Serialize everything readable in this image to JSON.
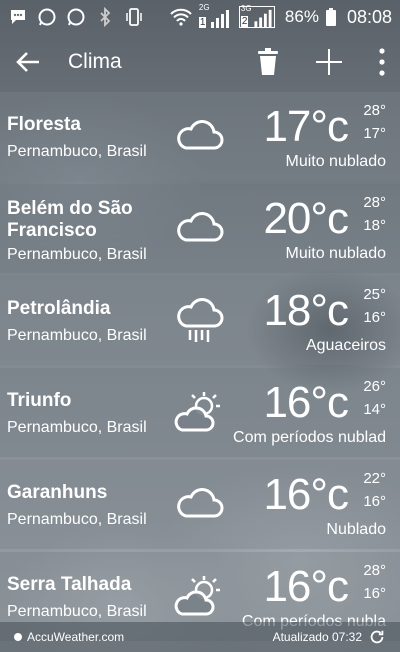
{
  "status": {
    "battery": "86%",
    "time": "08:08",
    "net1": "2G",
    "net2": "3G",
    "sim1": "1",
    "sim2": "2"
  },
  "appbar": {
    "title": "Clima"
  },
  "cities": [
    {
      "name": "Floresta",
      "region": "Pernambuco, Brasil",
      "temp": "17°c",
      "hi": "28°",
      "lo": "17°",
      "condition": "Muito nublado",
      "icon": "cloud"
    },
    {
      "name": "Belém do São Francisco",
      "region": "Pernambuco, Brasil",
      "temp": "20°c",
      "hi": "28°",
      "lo": "18°",
      "condition": "Muito nublado",
      "icon": "cloud"
    },
    {
      "name": "Petrolândia",
      "region": "Pernambuco, Brasil",
      "temp": "18°c",
      "hi": "25°",
      "lo": "16°",
      "condition": "Aguaceiros",
      "icon": "rain"
    },
    {
      "name": "Triunfo",
      "region": "Pernambuco, Brasil",
      "temp": "16°c",
      "hi": "26°",
      "lo": "14°",
      "condition": "Com períodos nublad",
      "icon": "partly-cloudy"
    },
    {
      "name": "Garanhuns",
      "region": "Pernambuco, Brasil",
      "temp": "16°c",
      "hi": "22°",
      "lo": "16°",
      "condition": "Nublado",
      "icon": "cloud"
    },
    {
      "name": "Serra Talhada",
      "region": "Pernambuco, Brasil",
      "temp": "16°c",
      "hi": "28°",
      "lo": "16°",
      "condition": "Com períodos nubla",
      "icon": "partly-cloudy"
    }
  ],
  "footer": {
    "provider": "AccuWeather.com",
    "updated": "Atualizado 07:32"
  }
}
